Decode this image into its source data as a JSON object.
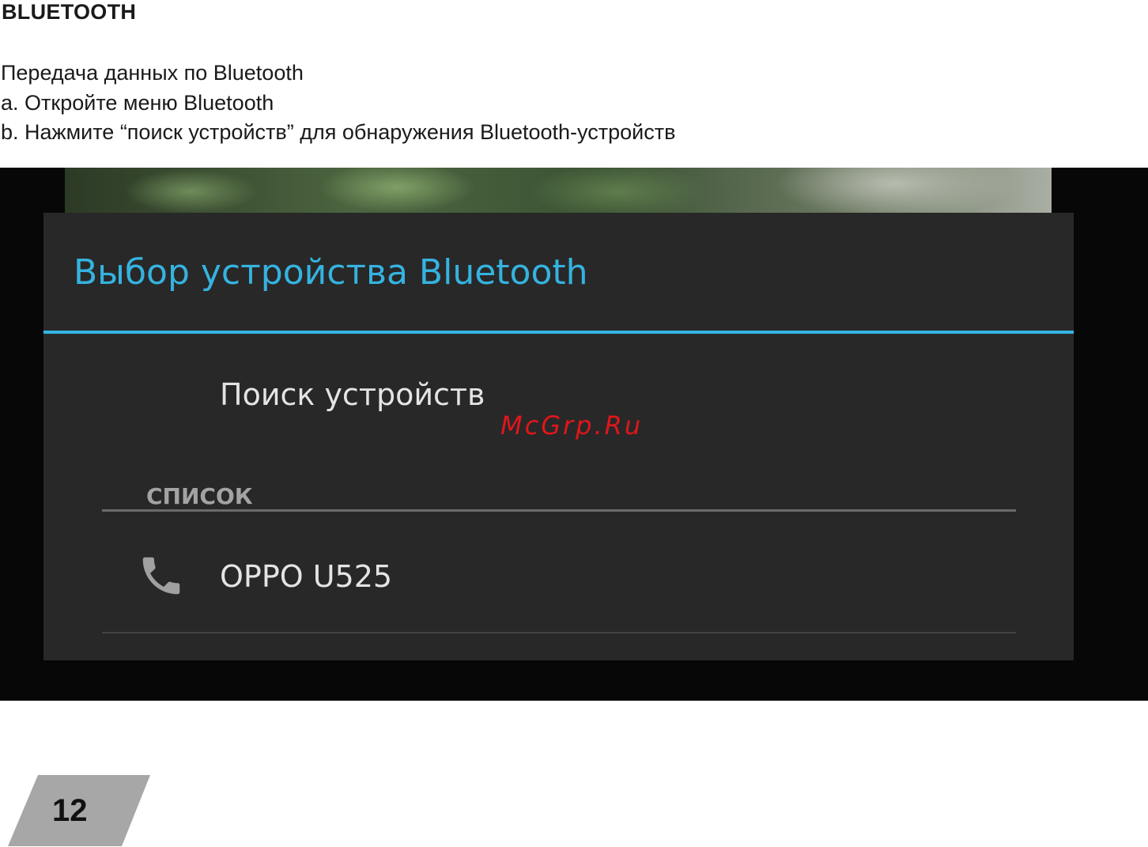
{
  "heading": "BLUETOOTH",
  "instructions": [
    "Передача данных по Bluetooth",
    "a. Откройте меню Bluetooth",
    "b. Нажмите “поиск устройств” для обнаружения Bluetooth-устройств"
  ],
  "dialog": {
    "title": "Выбор устройства Bluetooth",
    "scan_label": "Поиск устройств",
    "section_label": "СПИСОК",
    "devices": [
      {
        "name": "OPPO U525",
        "icon": "phone-icon"
      }
    ]
  },
  "watermark": "McGrp.Ru",
  "page_number": "12",
  "colors": {
    "accent": "#33b5e5",
    "dialog_bg": "#282828",
    "watermark": "#e0161b",
    "page_tab": "#a7a7a7"
  }
}
